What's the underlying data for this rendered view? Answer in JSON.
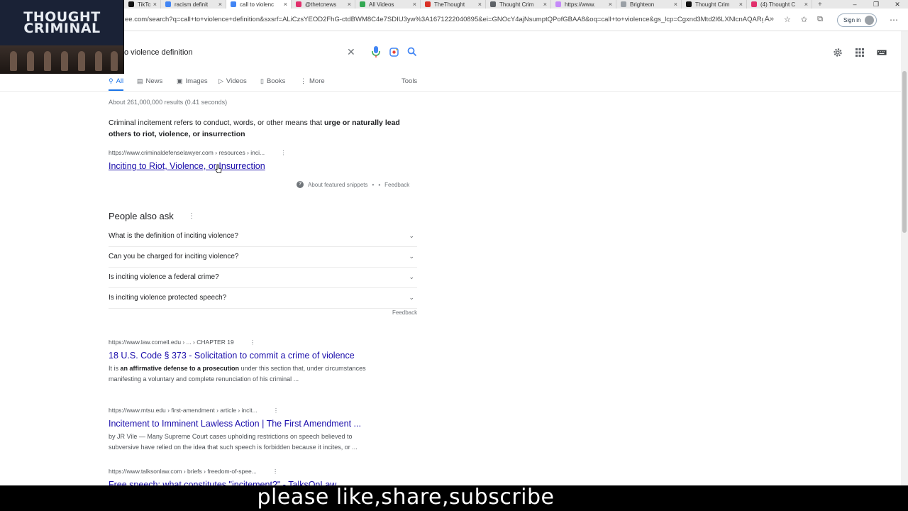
{
  "browser": {
    "tabs": [
      {
        "label": "TikTok",
        "color": "#111111"
      },
      {
        "label": "racism definit",
        "color": "#4285f4"
      },
      {
        "label": "call to violenc",
        "color": "#4285f4",
        "active": true
      },
      {
        "label": "@thetcnews",
        "color": "#e1306c"
      },
      {
        "label": "All Videos",
        "color": "#34a853"
      },
      {
        "label": "TheThought",
        "color": "#d93025"
      },
      {
        "label": "Thought Crim",
        "color": "#5f6368"
      },
      {
        "label": "https://www.",
        "color": "#c58af9"
      },
      {
        "label": "Brighteon",
        "color": "#9aa0a6"
      },
      {
        "label": "Thought Crim",
        "color": "#111111"
      },
      {
        "label": "(4) Thought C",
        "color": "#e1306c"
      }
    ],
    "url": "ee.com/search?q=call+to+violence+definition&sxsrf=ALiCzsYEOD2FhG-ctdBWM8C4e7SDIU3yw%3A1671222040895&ei=GNOcY4ajNsumptQPofGBAA8&oq=call+to+violence&gs_lcp=Cgxnd3Mtd2l6LXNlcnAQARgD...",
    "sign_in": "Sign in"
  },
  "video_overlay": {
    "title_line1": "THOUGHT",
    "title_line2": "CRIMINAL"
  },
  "search": {
    "query": "o violence definition",
    "tabs": [
      {
        "label": "All",
        "icon": "search-icon"
      },
      {
        "label": "News",
        "icon": "news-icon"
      },
      {
        "label": "Images",
        "icon": "images-icon"
      },
      {
        "label": "Videos",
        "icon": "videos-icon"
      },
      {
        "label": "Books",
        "icon": "books-icon"
      },
      {
        "label": "More",
        "icon": "more-icon"
      }
    ],
    "tools": "Tools",
    "stats": "About 261,000,000 results (0.41 seconds)"
  },
  "featured_snippet": {
    "text_plain": "Criminal incitement refers to conduct, words, or other means that ",
    "text_bold_1": "urge or naturally lead",
    "text_bold_2": "others to riot, violence, or insurrection",
    "cite": "https://www.criminaldefenselawyer.com › resources › inci...",
    "title": "Inciting to Riot, Violence, or Insurrection",
    "about": "About featured snippets",
    "feedback": "Feedback"
  },
  "people_also_ask": {
    "title": "People also ask",
    "questions": [
      "What is the definition of inciting violence?",
      "Can you be charged for inciting violence?",
      "Is inciting violence a federal crime?",
      "Is inciting violence protected speech?"
    ],
    "feedback": "Feedback"
  },
  "results": [
    {
      "cite": "https://www.law.cornell.edu › ... › CHAPTER 19",
      "title": "18 U.S. Code § 373 - Solicitation to commit a crime of violence",
      "snippet_pre": "It is ",
      "snippet_bold": "an affirmative defense to a prosecution",
      "snippet_post": " under this section that, under circumstances manifesting a voluntary and complete renunciation of his criminal ..."
    },
    {
      "cite": "https://www.mtsu.edu › first-amendment › article › incit...",
      "title": "Incitement to Imminent Lawless Action | The First Amendment ...",
      "snippet_pre": "by JR Vile — Many Supreme Court cases upholding restrictions on speech believed to subversive have relied on the idea that such speech is forbidden because it incites, or ...",
      "snippet_bold": "",
      "snippet_post": ""
    },
    {
      "cite": "https://www.talksonlaw.com › briefs › freedom-of-spee...",
      "title": "Free speech: what constitutes \"incitement?\" - TalksOnLaw",
      "snippet_pre": "",
      "snippet_bold": "",
      "snippet_post": ""
    }
  ],
  "caption": "please like,share,subscribe",
  "colors": {
    "link": "#1a0dab",
    "accent": "#1a73e8",
    "caption_bg": "#000000"
  }
}
